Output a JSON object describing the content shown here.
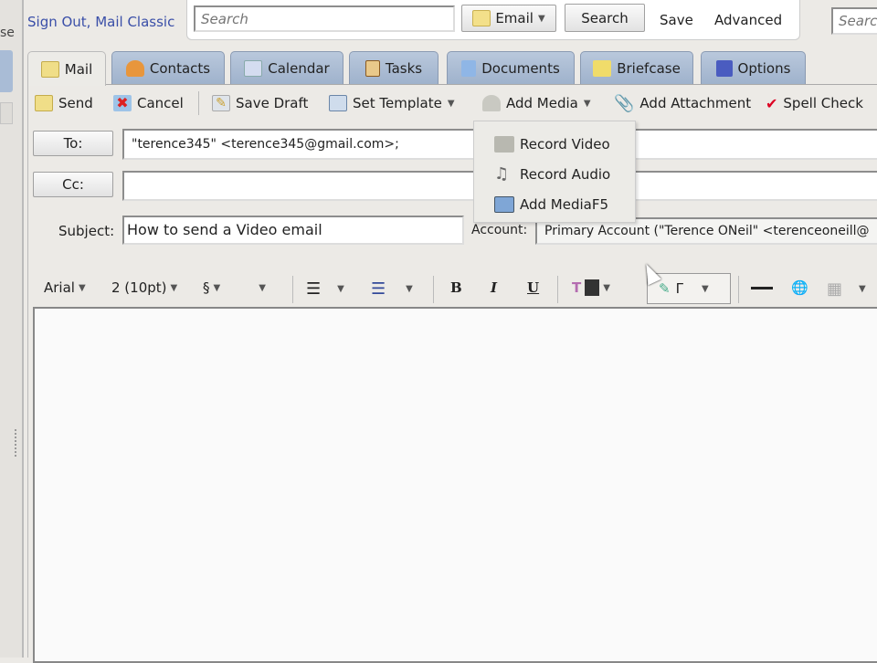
{
  "header": {
    "clipped_text": "se",
    "links": "Sign Out, Mail Classic",
    "search_placeholder": "Search",
    "search_type": "Email",
    "search_button": "Search",
    "save": "Save",
    "advanced": "Advanced",
    "right_search_placeholder": "Search"
  },
  "tabs": [
    {
      "label": "Mail"
    },
    {
      "label": "Contacts"
    },
    {
      "label": "Calendar"
    },
    {
      "label": "Tasks"
    },
    {
      "label": "Documents"
    },
    {
      "label": "Briefcase"
    },
    {
      "label": "Options"
    }
  ],
  "toolbar": {
    "send": "Send",
    "cancel": "Cancel",
    "save_draft": "Save Draft",
    "set_template": "Set Template",
    "add_media": "Add Media",
    "add_attachment": "Add Attachment",
    "spell_check": "Spell Check"
  },
  "media_menu": [
    {
      "label": "Record Video"
    },
    {
      "label": "Record Audio"
    },
    {
      "label": "Add MediaF5"
    }
  ],
  "compose": {
    "to_label": "To:",
    "to_value": "\"terence345\" <terence345@gmail.com>;",
    "cc_label": "Cc:",
    "cc_value": "",
    "subject_label": "Subject:",
    "subject_value": "How to send a Video email",
    "account_label": "Account:",
    "account_value": "Primary Account (\"Terence ONeil\" <terenceoneill@"
  },
  "format": {
    "font": "Arial",
    "size": "2 (10pt)",
    "style": "§",
    "bold": "B",
    "italic": "I",
    "underline": "U"
  }
}
